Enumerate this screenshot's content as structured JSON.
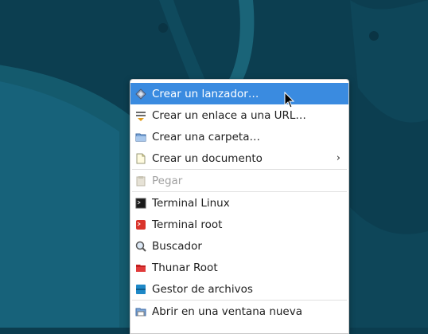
{
  "menu": {
    "items": [
      {
        "label": "Crear un lanzador…",
        "icon": "launcher-icon",
        "highlighted": true
      },
      {
        "label": "Crear un enlace a una URL…",
        "icon": "url-link-icon"
      },
      {
        "label": "Crear una carpeta…",
        "icon": "folder-icon"
      },
      {
        "label": "Crear un documento",
        "icon": "document-icon",
        "submenu": true
      },
      {
        "label": "Pegar",
        "icon": "clipboard-icon",
        "disabled": true
      },
      {
        "label": "Terminal Linux",
        "icon": "terminal-icon"
      },
      {
        "label": "Terminal root",
        "icon": "root-terminal-icon"
      },
      {
        "label": "Buscador",
        "icon": "search-icon"
      },
      {
        "label": "Thunar Root",
        "icon": "thunar-root-icon"
      },
      {
        "label": "Gestor de archivos",
        "icon": "file-manager-icon"
      },
      {
        "label": "Abrir en una ventana nueva",
        "icon": "new-window-icon"
      }
    ],
    "submenu_arrow": "›"
  },
  "colors": {
    "background": "#0b3d4f",
    "highlight": "#3a8be0",
    "disabled_text": "#a0a0a0"
  }
}
